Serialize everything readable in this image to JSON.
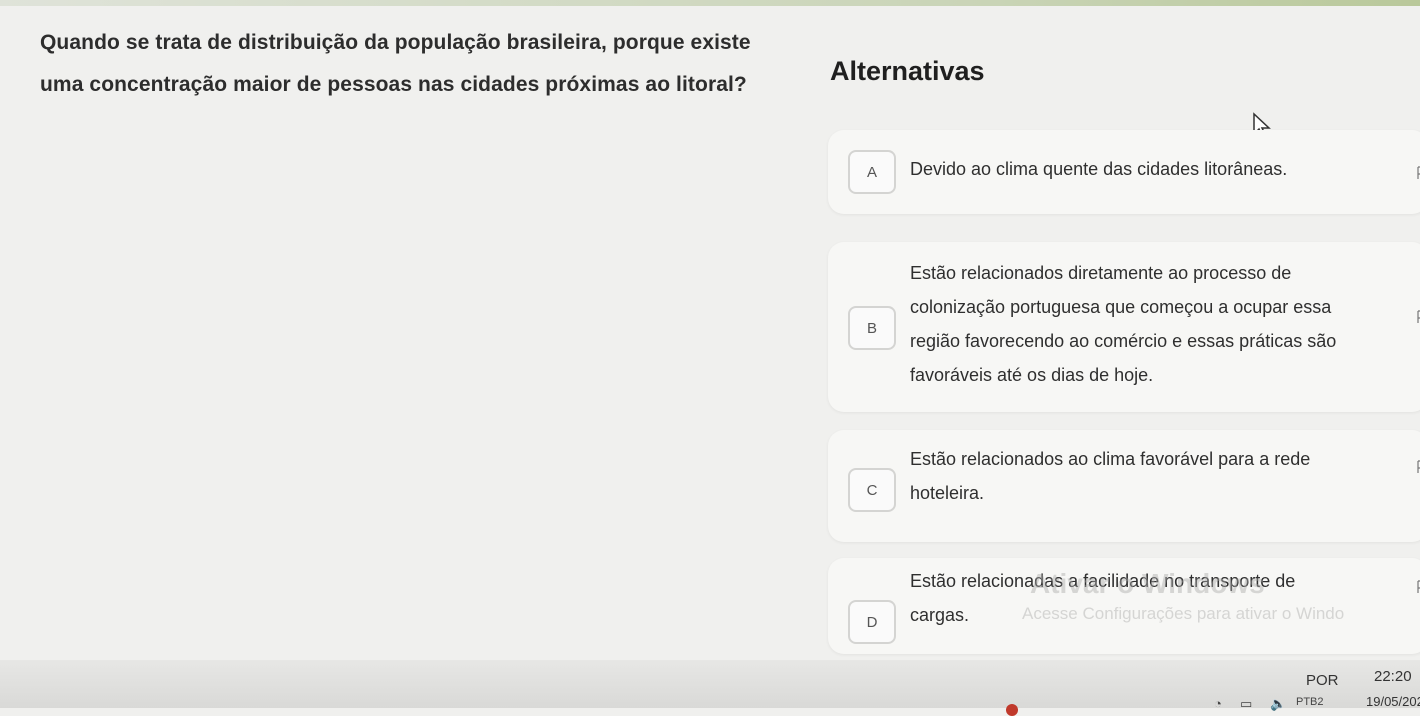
{
  "question": {
    "line1": "Quando se trata de distribuição da população brasileira, porque existe",
    "line2": "uma concentração maior de pessoas nas cidades próximas ao litoral?"
  },
  "alternatives_title": "Alternativas",
  "alternatives": [
    {
      "letter": "A",
      "lines": [
        "Devido ao clima quente das cidades litorâneas."
      ]
    },
    {
      "letter": "B",
      "lines": [
        "Estão relacionados diretamente ao processo de",
        "colonização portuguesa que começou a ocupar essa",
        "região favorecendo ao comércio e essas práticas são",
        "favoráveis até os dias de hoje."
      ]
    },
    {
      "letter": "C",
      "lines": [
        "Estão relacionados ao clima favorável para a rede",
        "hoteleira."
      ]
    },
    {
      "letter": "D",
      "lines": [
        "Estão relacionadas a facilidade no transporte de",
        "cargas."
      ]
    }
  ],
  "watermark": {
    "title": "Ativar o Windows",
    "subtitle": "Acesse Configurações para ativar o Windo"
  },
  "taskbar": {
    "language": "POR",
    "keyboard": "PTB2",
    "time": "22:20",
    "date": "19/05/202"
  },
  "icons": {
    "cursor": "mouse-pointer-icon",
    "flag": "flag-icon",
    "volume": "volume-icon",
    "network": "network-icon"
  },
  "colors": {
    "background": "#f0f0ee",
    "card": "#f7f7f5",
    "text": "#2f2f2f"
  }
}
